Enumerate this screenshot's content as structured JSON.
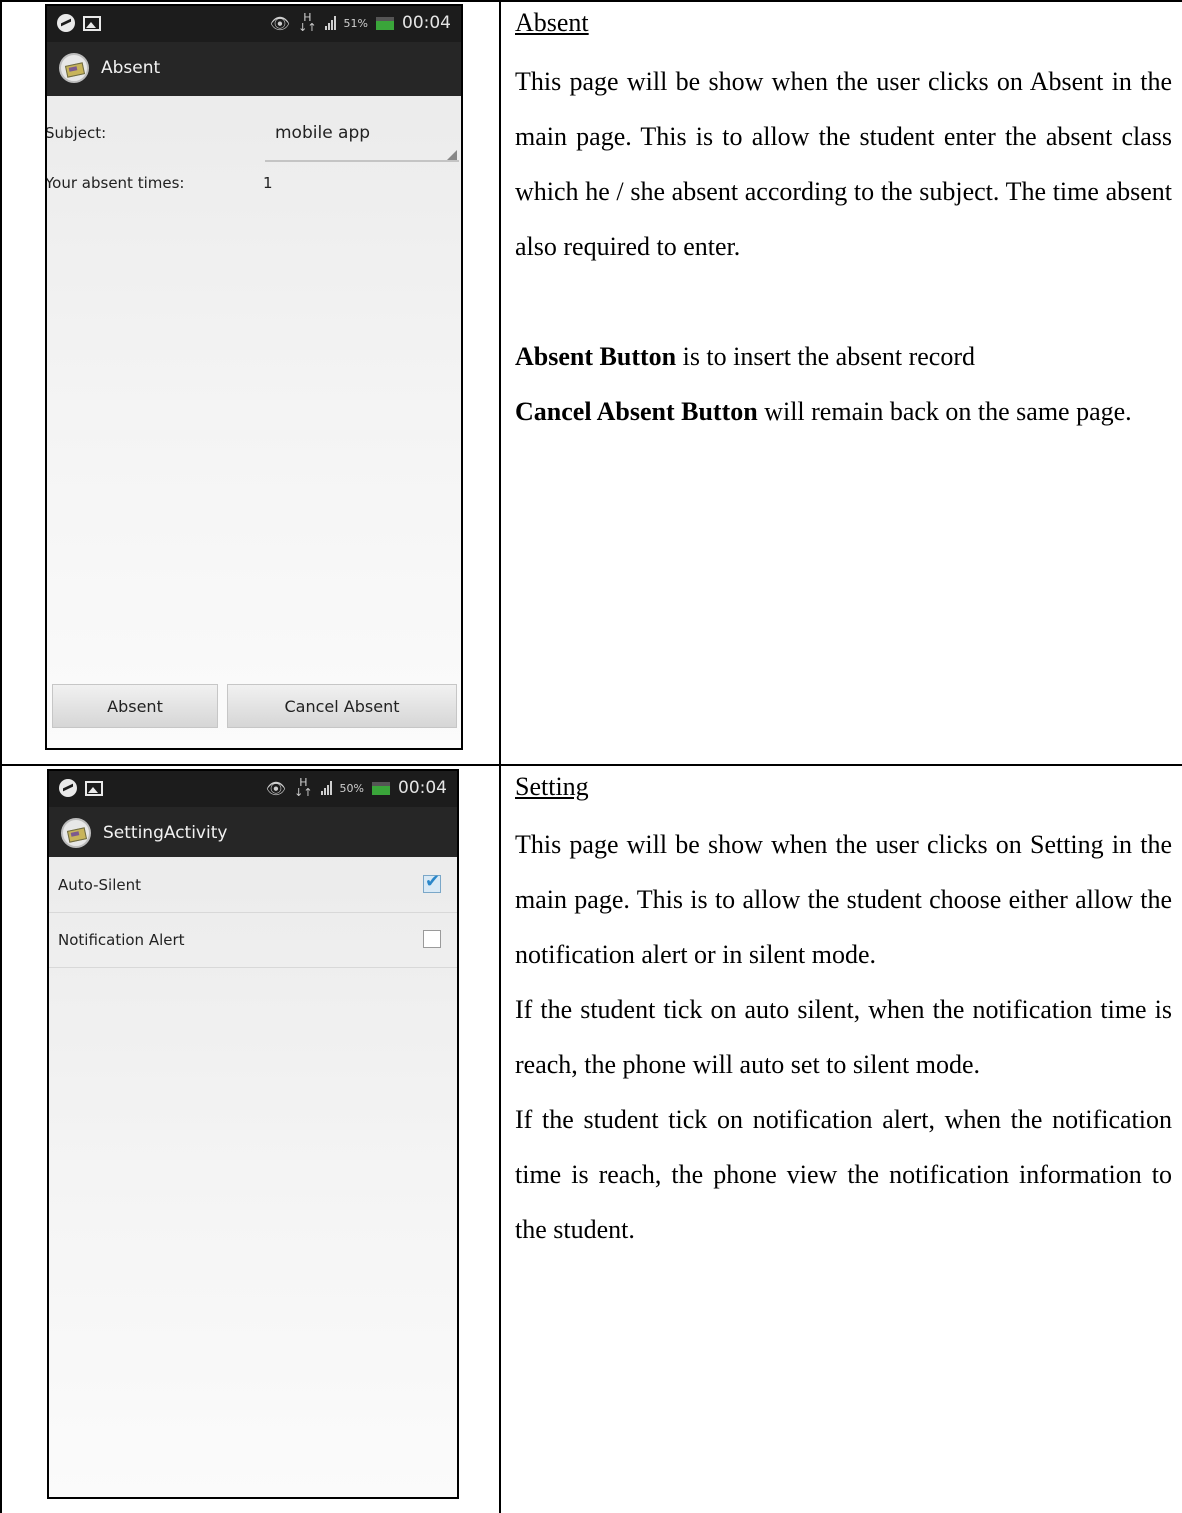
{
  "absent_screen": {
    "status_time": "00:04",
    "battery": "51%",
    "title": "Absent",
    "subject_label": "Subject:",
    "subject_value": "mobile app",
    "absent_times_label": "Your absent times:",
    "absent_times_value": "1",
    "absent_button": "Absent",
    "cancel_button": "Cancel Absent"
  },
  "absent_description": {
    "heading": "Absent",
    "paragraph": "This page will be show when the user clicks on Absent in the main page. This is to allow the student enter the absent class which he / she absent according to the subject. The time absent also required to enter.",
    "absent_button_bold": "Absent Button",
    "absent_button_text": " is to insert the absent record",
    "cancel_button_bold": "Cancel Absent Button",
    "cancel_button_text": " will remain back on the same page."
  },
  "setting_screen": {
    "status_time": "00:04",
    "battery": "50%",
    "title": "SettingActivity",
    "auto_silent_label": "Auto-Silent",
    "auto_silent_checked": true,
    "notification_label": "Notification Alert",
    "notification_checked": false
  },
  "setting_description": {
    "heading": "Setting",
    "paragraph1": "This page will be show when the user clicks on Setting in the main page. This is to allow the student choose either allow the notification alert or in silent mode.",
    "paragraph2": "If the student tick on auto silent, when the notification time is reach, the phone will auto set to silent mode.",
    "paragraph3": "If the student tick on notification alert, when the notification time is reach, the phone view the notification information to the student."
  }
}
